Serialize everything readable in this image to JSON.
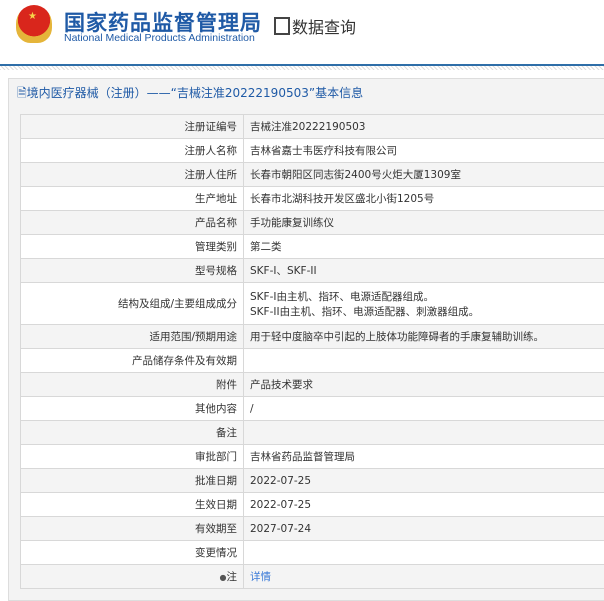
{
  "header": {
    "org_cn": "国家药品监督管理局",
    "org_en": "National Medical Products Administration",
    "query": "数据查询"
  },
  "panel_title": "境内医疗器械（注册）——“吉械注准20222190503”基本信息",
  "rows": [
    {
      "label": "注册证编号",
      "value": "吉械注准20222190503"
    },
    {
      "label": "注册人名称",
      "value": "吉林省嘉士韦医疗科技有限公司"
    },
    {
      "label": "注册人住所",
      "value": "长春市朝阳区同志街2400号火炬大厦1309室"
    },
    {
      "label": "生产地址",
      "value": "长春市北湖科技开发区盛北小街1205号"
    },
    {
      "label": "产品名称",
      "value": "手功能康复训练仪"
    },
    {
      "label": "管理类别",
      "value": "第二类"
    },
    {
      "label": "型号规格",
      "value": "SKF-I、SKF-II"
    },
    {
      "label": "结构及组成/主要组成成分",
      "value": "SKF-I由主机、指环、电源适配器组成。",
      "value2": "SKF-II由主机、指环、电源适配器、刺激器组成。"
    },
    {
      "label": "适用范围/预期用途",
      "value": "用于轻中度脑卒中引起的上肢体功能障碍者的手康复辅助训练。"
    },
    {
      "label": "产品储存条件及有效期",
      "value": ""
    },
    {
      "label": "附件",
      "value": "产品技术要求"
    },
    {
      "label": "其他内容",
      "value": "/"
    },
    {
      "label": "备注",
      "value": ""
    },
    {
      "label": "审批部门",
      "value": "吉林省药品监督管理局"
    },
    {
      "label": "批准日期",
      "value": "2022-07-25"
    },
    {
      "label": "生效日期",
      "value": "2022-07-25"
    },
    {
      "label": "有效期至",
      "value": "2027-07-24"
    },
    {
      "label": "变更情况",
      "value": ""
    },
    {
      "label": "注",
      "value": "详情"
    }
  ]
}
